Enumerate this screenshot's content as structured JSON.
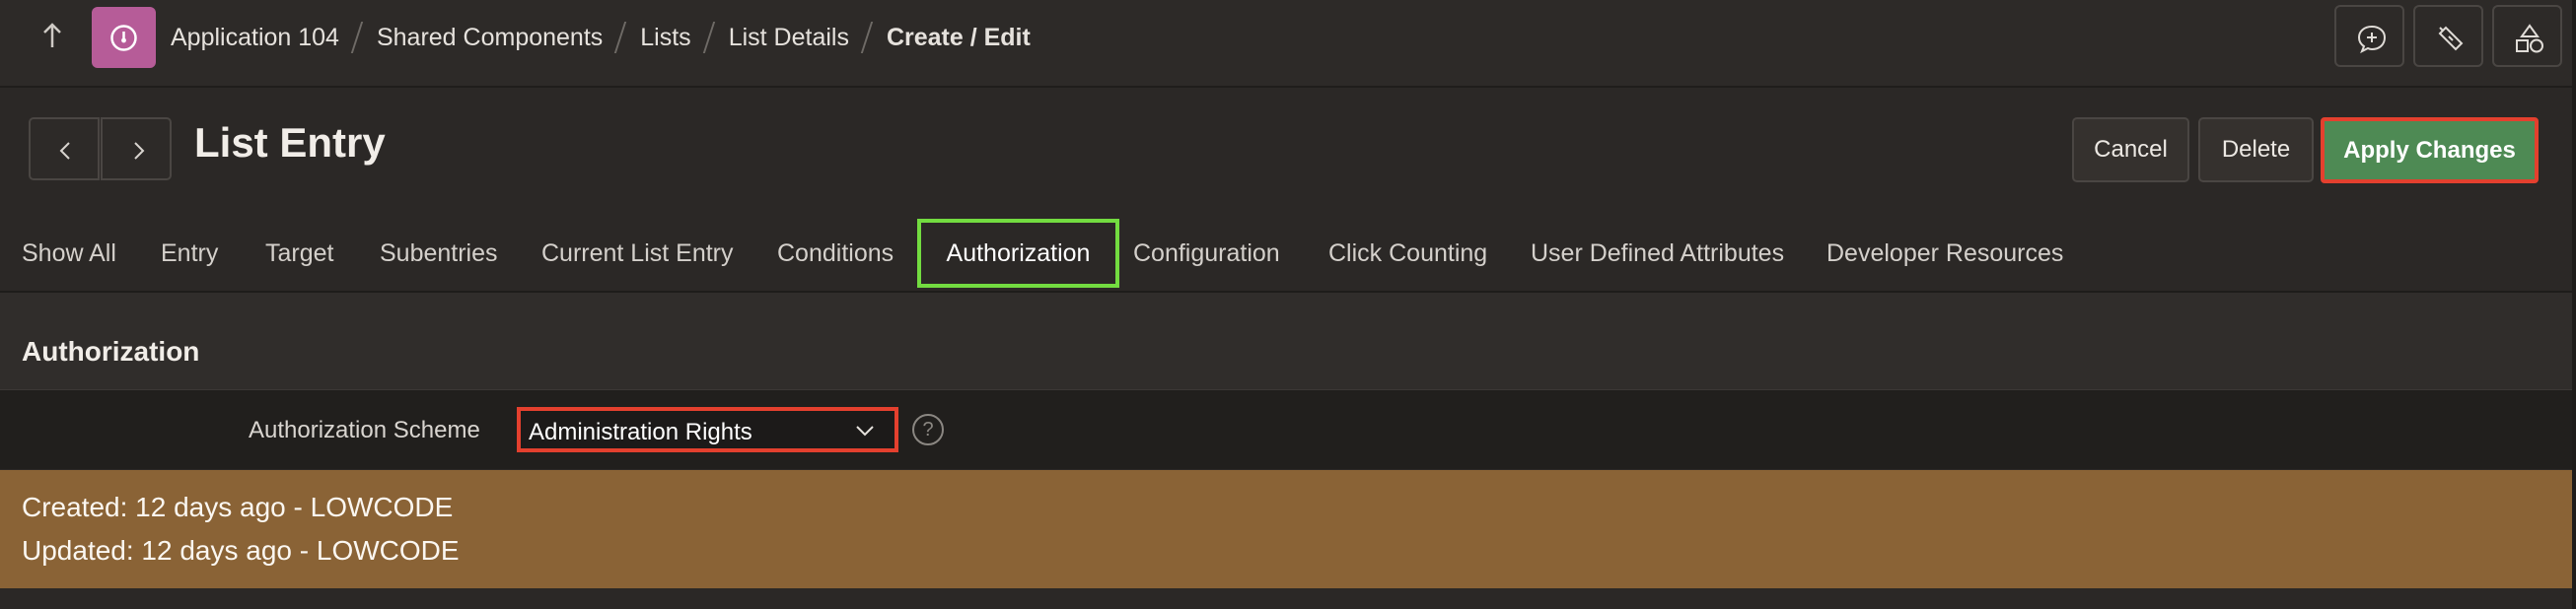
{
  "header": {
    "breadcrumbs": [
      "Application 104",
      "Shared Components",
      "Lists",
      "List Details"
    ],
    "current": "Create / Edit"
  },
  "title": "List Entry",
  "actions": {
    "cancel": "Cancel",
    "delete": "Delete",
    "apply": "Apply Changes"
  },
  "tabs": [
    "Show All",
    "Entry",
    "Target",
    "Subentries",
    "Current List Entry",
    "Conditions",
    "Authorization",
    "Configuration",
    "Click Counting",
    "User Defined Attributes",
    "Developer Resources"
  ],
  "active_tab": "Authorization",
  "region": {
    "title": "Authorization",
    "field_label": "Authorization Scheme",
    "field_value": "Administration Rights",
    "help_glyph": "?"
  },
  "audit": {
    "created": "Created: 12 days ago - LOWCODE",
    "updated": "Updated: 12 days ago - LOWCODE"
  },
  "colors": {
    "background": "#2b2826",
    "app_icon": "#b65c98",
    "apply_button": "#4e8a54",
    "highlight_red": "#e4402e",
    "highlight_green": "#73dc40",
    "audit_band": "#8a6336"
  },
  "icons": [
    "arrow-up-icon",
    "app-dial-icon",
    "comment-add-icon",
    "flashlight-icon",
    "shapes-icon",
    "chevron-left-icon",
    "chevron-right-icon",
    "chevron-down-icon",
    "help-icon"
  ]
}
